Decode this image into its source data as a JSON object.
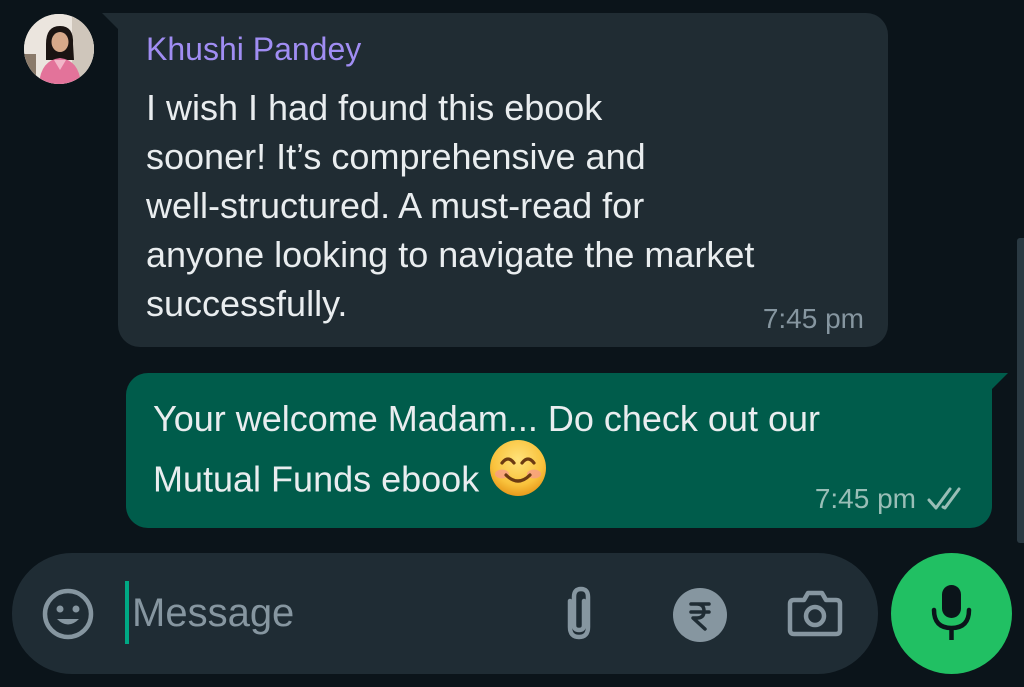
{
  "chat": {
    "incoming": {
      "sender": "Khushi Pandey",
      "lines": [
        "I wish I had found this ebook",
        "sooner! It’s comprehensive and",
        "well-structured. A must-read for",
        "anyone looking to navigate the market",
        "successfully."
      ],
      "time": "7:45 pm",
      "avatar_icon": "avatar-photo"
    },
    "outgoing": {
      "line1": "Your welcome Madam... Do check out our",
      "line2": "Mutual Funds ebook",
      "emoji": "smiling-face-emoji",
      "time": "7:45 pm",
      "status_icon": "double-check-icon"
    }
  },
  "composer": {
    "placeholder": "Message",
    "value": "",
    "icons": [
      "emoji-icon",
      "paperclip-icon",
      "rupee-icon",
      "camera-icon",
      "mic-icon"
    ]
  },
  "colors": {
    "background": "#0b141a",
    "incoming_bubble": "#202c33",
    "outgoing_bubble": "#005c4b",
    "sender_name": "#a08df3",
    "accent": "#21c063",
    "caret": "#00a884"
  }
}
